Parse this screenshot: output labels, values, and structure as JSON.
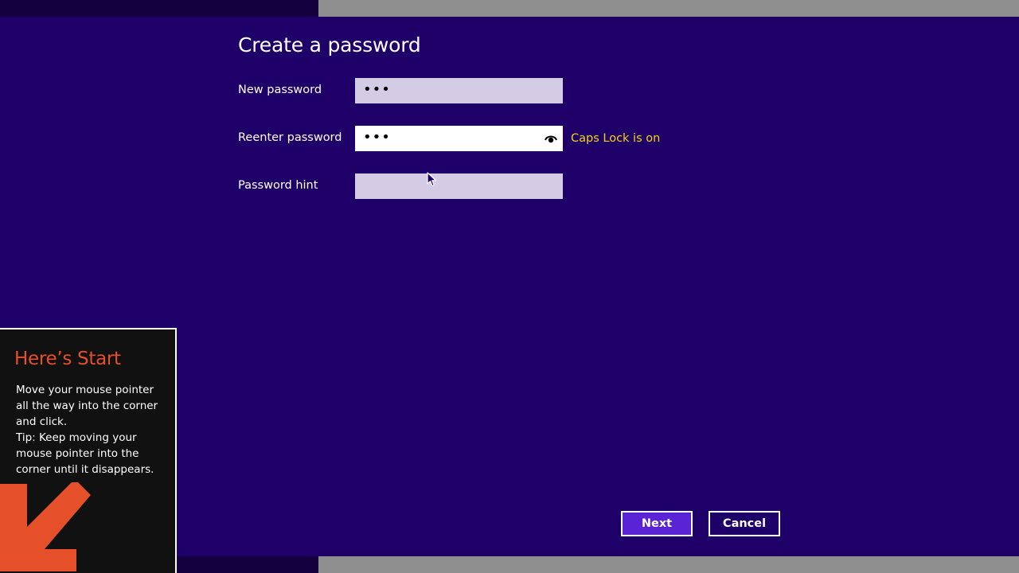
{
  "dialog": {
    "title": "Create a password",
    "fields": {
      "new_password": {
        "label": "New password",
        "masked_value": "•••"
      },
      "reenter_password": {
        "label": "Reenter password",
        "masked_value": "•••",
        "reveal_icon": "eye-icon"
      },
      "password_hint": {
        "label": "Password hint",
        "value": ""
      }
    },
    "caps_lock_warning": "Caps Lock is on",
    "buttons": {
      "next": "Next",
      "cancel": "Cancel"
    }
  },
  "start_tip": {
    "title": "Here’s Start",
    "line1": "Move your mouse pointer all the way into the corner and click.",
    "line2": "Tip: Keep moving your mouse pointer into the corner until it disappears.",
    "arrow_icon": "arrow-down-left-icon"
  },
  "colors": {
    "background": "#1e0068",
    "accent_button": "#5a24d6",
    "warning_text": "#f5d21a",
    "tip_title": "#e5502b",
    "tip_arrow": "#e5502b",
    "inactive_field": "#d4cbe4"
  }
}
